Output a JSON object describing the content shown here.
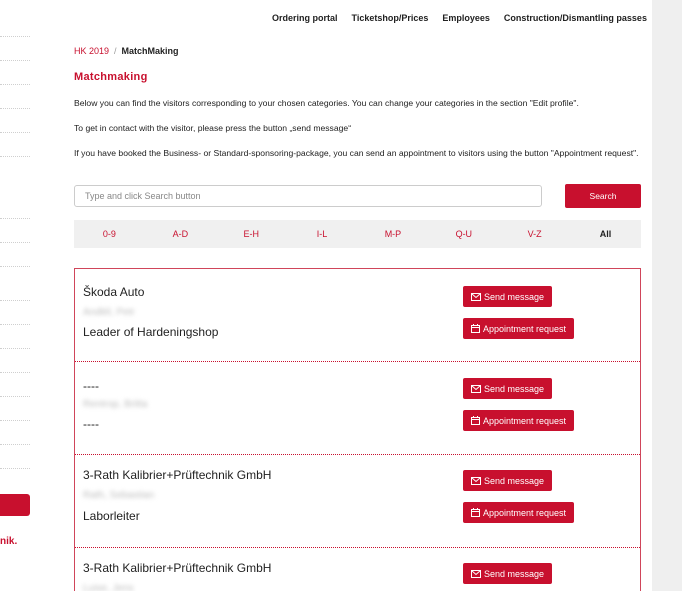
{
  "topnav": {
    "items": [
      "Ordering portal",
      "Ticketshop/Prices",
      "Employees",
      "Construction/Dismantling passes"
    ]
  },
  "breadcrumb": {
    "home": "HK 2019",
    "separator": "/",
    "current": "MatchMaking"
  },
  "page_title": "Matchmaking",
  "paragraphs": [
    "Below you can find the visitors corresponding to your chosen categories. You can change your categories in the section \"Edit profile\".",
    "To get in contact with the visitor, please press the button „send message“",
    "If you have booked the Business- or Standard-sponsoring-package, you can send an appointment to visitors using the button \"Appointment request\"."
  ],
  "search": {
    "placeholder": "Type and click Search button",
    "button_label": "Search"
  },
  "filters": [
    "0-9",
    "A-D",
    "E-H",
    "I-L",
    "M-P",
    "Q-U",
    "V-Z",
    "All"
  ],
  "active_filter": "All",
  "sidebar": {
    "partial_text": "nik."
  },
  "buttons": {
    "send_message": "Send message",
    "appointment_request": "Appointment request"
  },
  "visitors": [
    {
      "company": "Škoda Auto",
      "name": "Andlél, Petr",
      "role": "Leader of Hardeningshop"
    },
    {
      "company": "----",
      "name": "Rentrop, Britta",
      "role": "----"
    },
    {
      "company": "3-Rath Kalibrier+Prüftechnik GmbH",
      "name": "Rath, Sebastian",
      "role": "Laborleiter"
    },
    {
      "company": "3-Rath Kalibrier+Prüftechnik GmbH",
      "name": "Luise, Jens",
      "role": ""
    }
  ],
  "colors": {
    "accent": "#c8102e",
    "filter_bg": "#f0f0f0"
  }
}
